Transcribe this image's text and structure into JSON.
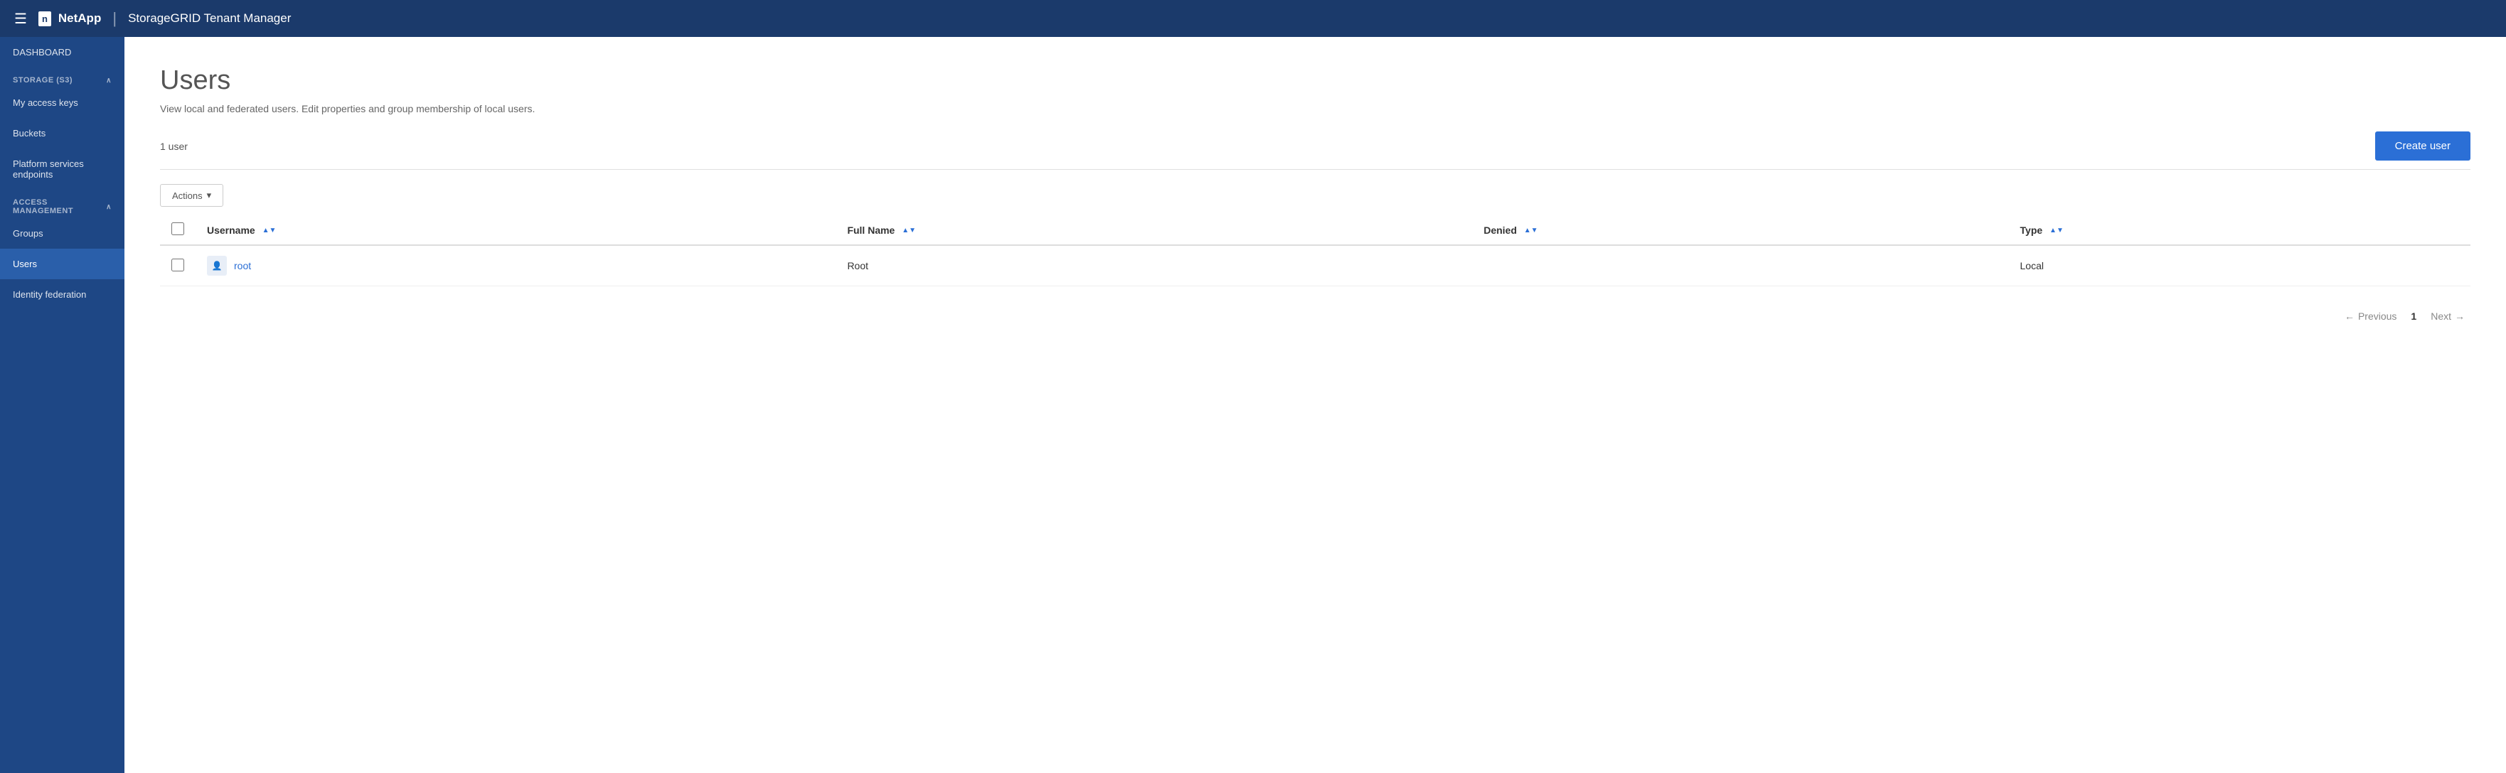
{
  "topbar": {
    "hamburger_label": "☰",
    "logo_icon": "n",
    "logo_text": "NetApp",
    "divider": "|",
    "app_title": "StorageGRID Tenant Manager"
  },
  "sidebar": {
    "dashboard_label": "DASHBOARD",
    "storage_section": "STORAGE (S3)",
    "storage_caret": "∧",
    "my_access_keys_label": "My access keys",
    "buckets_label": "Buckets",
    "platform_services_label": "Platform services endpoints",
    "access_mgmt_section": "ACCESS MANAGEMENT",
    "access_mgmt_caret": "∧",
    "groups_label": "Groups",
    "users_label": "Users",
    "identity_federation_label": "Identity federation"
  },
  "page": {
    "title": "Users",
    "description": "View local and federated users. Edit properties and group membership of local users.",
    "user_count": "1 user",
    "create_user_btn": "Create user"
  },
  "actions": {
    "label": "Actions",
    "caret": "▾"
  },
  "table": {
    "columns": [
      {
        "key": "username",
        "label": "Username"
      },
      {
        "key": "full_name",
        "label": "Full Name"
      },
      {
        "key": "denied",
        "label": "Denied"
      },
      {
        "key": "type",
        "label": "Type"
      }
    ],
    "rows": [
      {
        "username": "root",
        "full_name": "Root",
        "denied": "",
        "type": "Local"
      }
    ]
  },
  "pagination": {
    "previous_label": "Previous",
    "next_label": "Next",
    "current_page": "1",
    "left_arrow": "←",
    "right_arrow": "→"
  }
}
